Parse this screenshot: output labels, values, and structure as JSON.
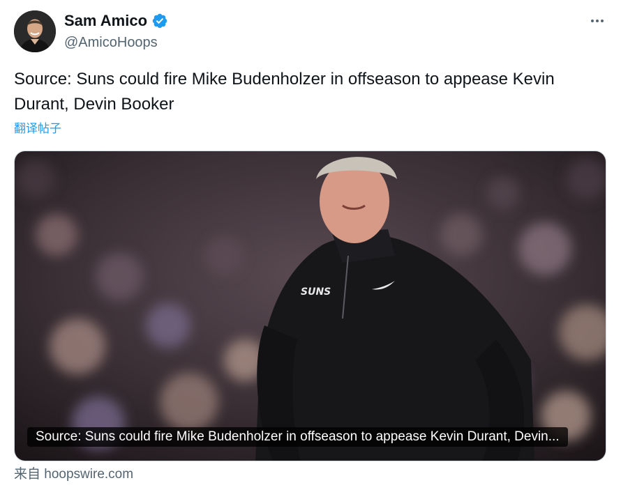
{
  "author": {
    "display_name": "Sam Amico",
    "handle": "@AmicoHoops",
    "verified": true,
    "avatar_icon": "avatar-photo"
  },
  "menu": {
    "icon": "more-horizontal-icon"
  },
  "tweet": {
    "text": "Source: Suns could fire Mike Budenholzer in offseason to appease Kevin Durant, Devin Booker",
    "translate_label": "翻译帖子"
  },
  "card": {
    "caption": "Source: Suns could fire Mike Budenholzer in offseason to appease Kevin Durant, Devin...",
    "jacket_logo": "SUNS",
    "source_label": "来自 hoopswire.com"
  },
  "colors": {
    "accent": "#1d9bf0",
    "text_primary": "#0f1419",
    "text_secondary": "#536471"
  }
}
